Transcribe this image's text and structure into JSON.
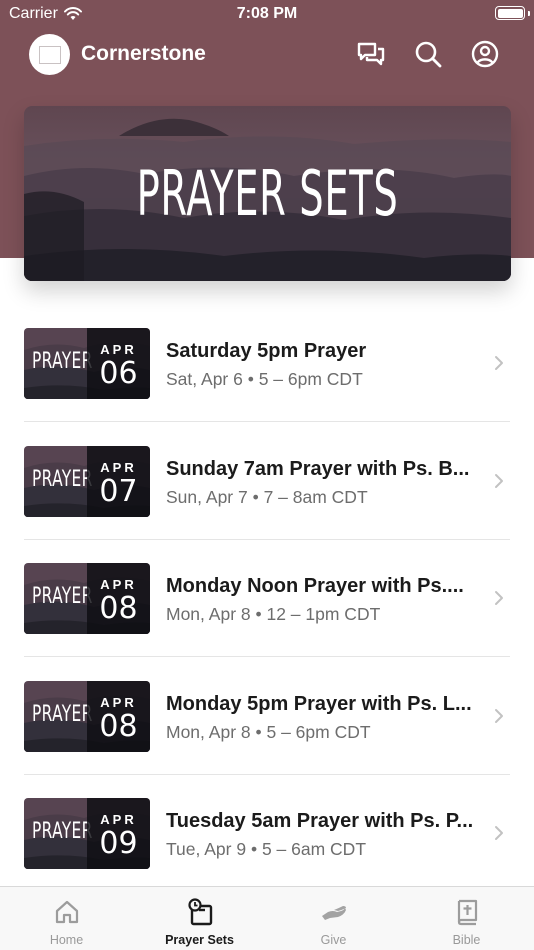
{
  "status_bar": {
    "carrier": "Carrier",
    "time": "7:08 PM"
  },
  "header": {
    "app_name": "Cornerstone",
    "icons": [
      "chat-icon",
      "search-icon",
      "account-icon"
    ]
  },
  "hero": {
    "title": "PRAYER SETS"
  },
  "prayer_sets": [
    {
      "thumb_word": "PRAYER",
      "month": "APR",
      "day": "06",
      "title": "Saturday 5pm Prayer",
      "subtitle": "Sat, Apr 6 • 5 – 6pm CDT"
    },
    {
      "thumb_word": "PRAYER",
      "month": "APR",
      "day": "07",
      "title": "Sunday 7am Prayer with Ps. B...",
      "subtitle": "Sun, Apr 7 • 7 – 8am CDT"
    },
    {
      "thumb_word": "PRAYER",
      "month": "APR",
      "day": "08",
      "title": "Monday Noon Prayer with Ps....",
      "subtitle": "Mon, Apr 8 • 12 – 1pm CDT"
    },
    {
      "thumb_word": "PRAYER",
      "month": "APR",
      "day": "08",
      "title": "Monday 5pm Prayer with Ps. L...",
      "subtitle": "Mon, Apr 8 • 5 – 6pm CDT"
    },
    {
      "thumb_word": "PRAYER",
      "month": "APR",
      "day": "09",
      "title": "Tuesday 5am Prayer with Ps. P...",
      "subtitle": "Tue, Apr 9 • 5 – 6am CDT"
    }
  ],
  "tabs": [
    {
      "label": "Home",
      "icon": "home-icon",
      "active": false
    },
    {
      "label": "Prayer Sets",
      "icon": "prayer-sets-icon",
      "active": true
    },
    {
      "label": "Give",
      "icon": "give-icon",
      "active": false
    },
    {
      "label": "Bible",
      "icon": "bible-icon",
      "active": false
    }
  ],
  "colors": {
    "header": "#7d5158",
    "active_tab": "#1b1b1b",
    "inactive_tab": "#999999"
  }
}
